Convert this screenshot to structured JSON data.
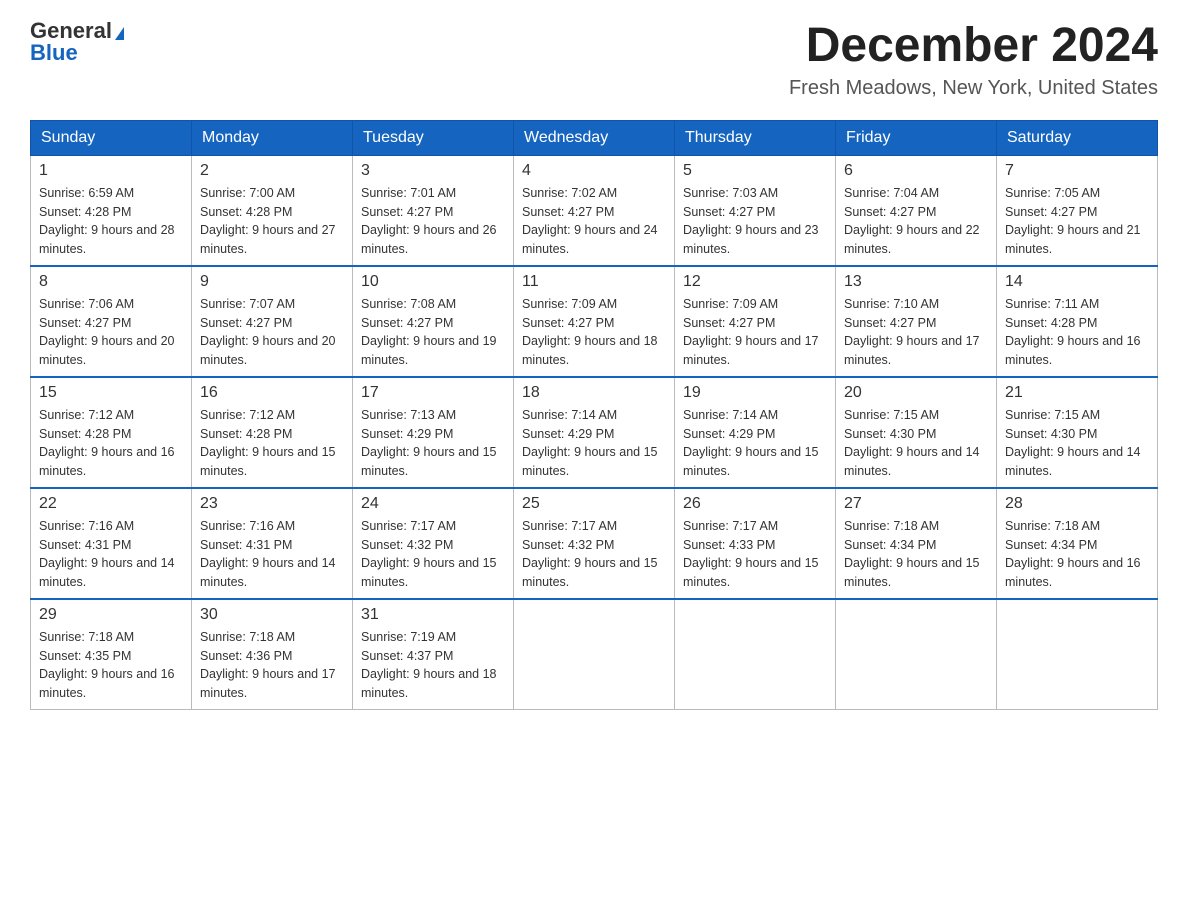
{
  "logo": {
    "general": "General",
    "blue": "Blue"
  },
  "header": {
    "month": "December 2024",
    "location": "Fresh Meadows, New York, United States"
  },
  "weekdays": [
    "Sunday",
    "Monday",
    "Tuesday",
    "Wednesday",
    "Thursday",
    "Friday",
    "Saturday"
  ],
  "weeks": [
    [
      {
        "day": "1",
        "sunrise": "6:59 AM",
        "sunset": "4:28 PM",
        "daylight": "9 hours and 28 minutes."
      },
      {
        "day": "2",
        "sunrise": "7:00 AM",
        "sunset": "4:28 PM",
        "daylight": "9 hours and 27 minutes."
      },
      {
        "day": "3",
        "sunrise": "7:01 AM",
        "sunset": "4:27 PM",
        "daylight": "9 hours and 26 minutes."
      },
      {
        "day": "4",
        "sunrise": "7:02 AM",
        "sunset": "4:27 PM",
        "daylight": "9 hours and 24 minutes."
      },
      {
        "day": "5",
        "sunrise": "7:03 AM",
        "sunset": "4:27 PM",
        "daylight": "9 hours and 23 minutes."
      },
      {
        "day": "6",
        "sunrise": "7:04 AM",
        "sunset": "4:27 PM",
        "daylight": "9 hours and 22 minutes."
      },
      {
        "day": "7",
        "sunrise": "7:05 AM",
        "sunset": "4:27 PM",
        "daylight": "9 hours and 21 minutes."
      }
    ],
    [
      {
        "day": "8",
        "sunrise": "7:06 AM",
        "sunset": "4:27 PM",
        "daylight": "9 hours and 20 minutes."
      },
      {
        "day": "9",
        "sunrise": "7:07 AM",
        "sunset": "4:27 PM",
        "daylight": "9 hours and 20 minutes."
      },
      {
        "day": "10",
        "sunrise": "7:08 AM",
        "sunset": "4:27 PM",
        "daylight": "9 hours and 19 minutes."
      },
      {
        "day": "11",
        "sunrise": "7:09 AM",
        "sunset": "4:27 PM",
        "daylight": "9 hours and 18 minutes."
      },
      {
        "day": "12",
        "sunrise": "7:09 AM",
        "sunset": "4:27 PM",
        "daylight": "9 hours and 17 minutes."
      },
      {
        "day": "13",
        "sunrise": "7:10 AM",
        "sunset": "4:27 PM",
        "daylight": "9 hours and 17 minutes."
      },
      {
        "day": "14",
        "sunrise": "7:11 AM",
        "sunset": "4:28 PM",
        "daylight": "9 hours and 16 minutes."
      }
    ],
    [
      {
        "day": "15",
        "sunrise": "7:12 AM",
        "sunset": "4:28 PM",
        "daylight": "9 hours and 16 minutes."
      },
      {
        "day": "16",
        "sunrise": "7:12 AM",
        "sunset": "4:28 PM",
        "daylight": "9 hours and 15 minutes."
      },
      {
        "day": "17",
        "sunrise": "7:13 AM",
        "sunset": "4:29 PM",
        "daylight": "9 hours and 15 minutes."
      },
      {
        "day": "18",
        "sunrise": "7:14 AM",
        "sunset": "4:29 PM",
        "daylight": "9 hours and 15 minutes."
      },
      {
        "day": "19",
        "sunrise": "7:14 AM",
        "sunset": "4:29 PM",
        "daylight": "9 hours and 15 minutes."
      },
      {
        "day": "20",
        "sunrise": "7:15 AM",
        "sunset": "4:30 PM",
        "daylight": "9 hours and 14 minutes."
      },
      {
        "day": "21",
        "sunrise": "7:15 AM",
        "sunset": "4:30 PM",
        "daylight": "9 hours and 14 minutes."
      }
    ],
    [
      {
        "day": "22",
        "sunrise": "7:16 AM",
        "sunset": "4:31 PM",
        "daylight": "9 hours and 14 minutes."
      },
      {
        "day": "23",
        "sunrise": "7:16 AM",
        "sunset": "4:31 PM",
        "daylight": "9 hours and 14 minutes."
      },
      {
        "day": "24",
        "sunrise": "7:17 AM",
        "sunset": "4:32 PM",
        "daylight": "9 hours and 15 minutes."
      },
      {
        "day": "25",
        "sunrise": "7:17 AM",
        "sunset": "4:32 PM",
        "daylight": "9 hours and 15 minutes."
      },
      {
        "day": "26",
        "sunrise": "7:17 AM",
        "sunset": "4:33 PM",
        "daylight": "9 hours and 15 minutes."
      },
      {
        "day": "27",
        "sunrise": "7:18 AM",
        "sunset": "4:34 PM",
        "daylight": "9 hours and 15 minutes."
      },
      {
        "day": "28",
        "sunrise": "7:18 AM",
        "sunset": "4:34 PM",
        "daylight": "9 hours and 16 minutes."
      }
    ],
    [
      {
        "day": "29",
        "sunrise": "7:18 AM",
        "sunset": "4:35 PM",
        "daylight": "9 hours and 16 minutes."
      },
      {
        "day": "30",
        "sunrise": "7:18 AM",
        "sunset": "4:36 PM",
        "daylight": "9 hours and 17 minutes."
      },
      {
        "day": "31",
        "sunrise": "7:19 AM",
        "sunset": "4:37 PM",
        "daylight": "9 hours and 18 minutes."
      },
      null,
      null,
      null,
      null
    ]
  ]
}
